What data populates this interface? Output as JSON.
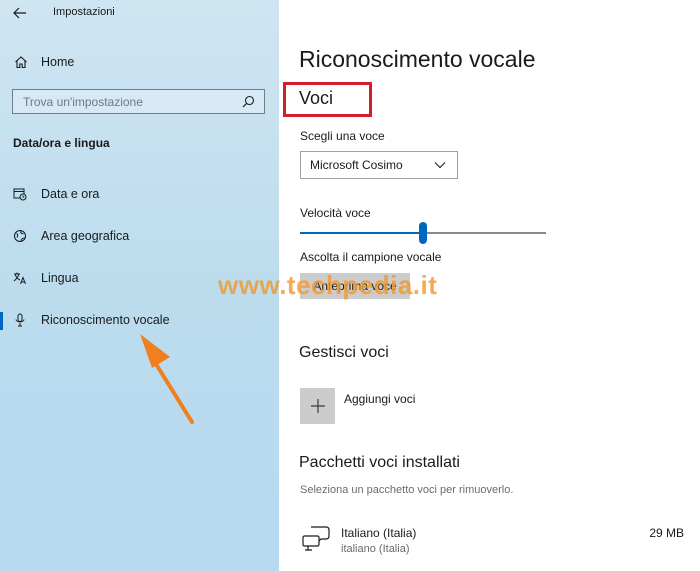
{
  "window": {
    "title": "Impostazioni"
  },
  "sidebar": {
    "home_label": "Home",
    "search": {
      "placeholder": "Trova un'impostazione"
    },
    "section_title": "Data/ora e lingua",
    "items": [
      {
        "label": "Data e ora",
        "icon": "calendar-clock-icon"
      },
      {
        "label": "Area geografica",
        "icon": "globe-icon"
      },
      {
        "label": "Lingua",
        "icon": "language-icon"
      },
      {
        "label": "Riconoscimento vocale",
        "icon": "microphone-icon",
        "selected": true
      }
    ]
  },
  "main": {
    "page_title": "Riconoscimento vocale",
    "voci_heading": "Voci",
    "voice_select": {
      "label": "Scegli una voce",
      "value": "Microsoft Cosimo"
    },
    "speed": {
      "label": "Velocità voce",
      "value_fraction": 0.5
    },
    "sample": {
      "label": "Ascolta il campione vocale",
      "button": "Anteprima voce"
    },
    "manage": {
      "heading": "Gestisci voci",
      "add_label": "Aggiungi voci"
    },
    "installed": {
      "heading": "Pacchetti voci installati",
      "hint": "Seleziona un pacchetto voci per rimuoverlo.",
      "packages": [
        {
          "name": "Italiano (Italia)",
          "subtitle": "italiano (Italia)",
          "size": "29 MB"
        }
      ]
    }
  },
  "watermark": {
    "text": "www.techpedia.it"
  },
  "colors": {
    "accent": "#0067c0",
    "highlight_box": "#d21f2c",
    "annotation_arrow": "#f07f1e",
    "sidebar_bg": "#bcdcee"
  }
}
